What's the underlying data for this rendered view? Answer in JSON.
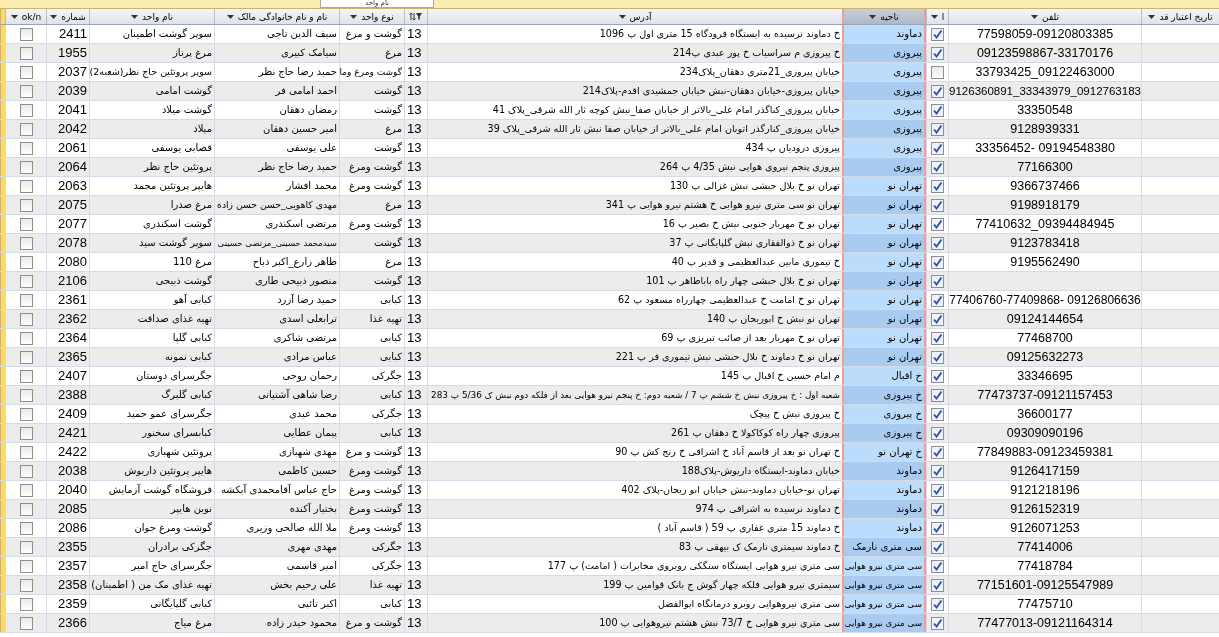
{
  "top_field": {
    "value": "نام واحد"
  },
  "table": {
    "columns": [
      {
        "label": "تاریخ اعتبار قد",
        "kind": "date",
        "selected": false
      },
      {
        "label": "تلفن",
        "kind": "phone",
        "selected": false
      },
      {
        "label": "ا",
        "kind": "checkbox",
        "selected": false
      },
      {
        "label": "ناحیه",
        "kind": "text",
        "selected": true
      },
      {
        "label": "آدرس",
        "kind": "text",
        "selected": false
      },
      {
        "kind": "code",
        "selected": false
      },
      {
        "label": "نوع واحد",
        "kind": "text",
        "selected": false
      },
      {
        "label": "نام و نام خانوادگی مالک",
        "kind": "text",
        "selected": false
      },
      {
        "label": "نام واحد",
        "kind": "text",
        "selected": false
      },
      {
        "label": "شماره",
        "kind": "text",
        "selected": false
      },
      {
        "label": "ok/n",
        "kind": "checkbox",
        "selected": false
      }
    ],
    "rows": [
      {
        "ok": false,
        "number": "2411",
        "unit_name": "سوپر گوشت اطمینان",
        "owner": "سیف الدین تاجی",
        "unit_type": "گوشت و مرغ",
        "column_6": "13",
        "address": "خ دماوند نرسیده به ایستگاه فرودگاه 15 متری اول پ 1096",
        "region": "دماوند",
        "column_9": true,
        "phone": "77598059-09120803385"
      },
      {
        "ok": false,
        "number": "1955",
        "unit_name": "مرغ پرناز",
        "owner": "سیامک کبیری",
        "unit_type": "مرغ",
        "column_6": "13",
        "address": "خ پیروزی م سراسیاب خ پور عبدی  پ214",
        "region": "پیروزی",
        "column_9": true,
        "phone": "09123598867-33170176"
      },
      {
        "ok": false,
        "number": "2037",
        "unit_name": "سوپر پروتئین حاج نظر(شعبه2)",
        "owner": "حمید رضا حاج نظر",
        "unit_type": "گوشت ومرغ وما",
        "column_6": "13",
        "address": "خیابان پیروزی_21متری دهقان_پلاک234",
        "region": "پیروزی",
        "column_9": false,
        "phone": "33793425_09122463000"
      },
      {
        "ok": false,
        "number": "2039",
        "unit_name": "گوشت امامی",
        "owner": "احمد امامی فر",
        "unit_type": "گوشت",
        "column_6": "13",
        "address": "خیابان پیروزی-خیابان دهقان-نبش خیابان جمشیدی اقدم-پلاک214",
        "region": "پیروزی",
        "column_9": true,
        "phone": "9126360891_33343979_0912763183"
      },
      {
        "ok": false,
        "number": "2041",
        "unit_name": "گوشت میلاد",
        "owner": "رمضان دهقان",
        "unit_type": "گوشت",
        "column_6": "13",
        "address": "خیابان پیروزی_کناگذر امام علی_بالاتر از خیابان صفا_نبش کوچه ثار الله شرقی_پلاک 41",
        "region": "پیروزی",
        "column_9": true,
        "phone": "33350548"
      },
      {
        "ok": false,
        "number": "2042",
        "unit_name": "میلاد",
        "owner": "امیر حسین دهقان",
        "unit_type": "مرغ",
        "column_6": "13",
        "address": "خیابان پیروزی_کنارگذر اتوبان امام علی_بالاتر از خیابان صفا نبش ثار الله شرقی_پلاک 39",
        "region": "پیروزی",
        "column_9": true,
        "phone": "9128939331"
      },
      {
        "ok": false,
        "number": "2061",
        "unit_name": "قصابی یوسفی",
        "owner": "علی یوسفی",
        "unit_type": "گوشت",
        "column_6": "13",
        "address": "پیروزی درودیان پ 434",
        "region": "پیروزی",
        "column_9": true,
        "phone": "33356452- 09194548380"
      },
      {
        "ok": false,
        "number": "2064",
        "unit_name": "پروتئین حاج نظر",
        "owner": "حمید رضا حاج نظر",
        "unit_type": "گوشت ومرغ",
        "column_6": "13",
        "address": "پیروزی پنجم نیروی هوایی نبش 4/35 پ 264",
        "region": "پیروزی",
        "column_9": true,
        "phone": "77166300"
      },
      {
        "ok": false,
        "number": "2063",
        "unit_name": "هایپر پروتئین محمد",
        "owner": "محمد افشار",
        "unit_type": "گوشت ومرغ",
        "column_6": "13",
        "address": "تهران نو خ بلال حبشی نبش غزالی پ 130",
        "region": "تهران نو",
        "column_9": true,
        "phone": "9366737466"
      },
      {
        "ok": false,
        "number": "2075",
        "unit_name": "مرغ صدرا",
        "owner": "مهدی کاهویی_حسن حسن زاده",
        "unit_type": "مرغ",
        "column_6": "13",
        "address": "تهران نو سی متری نیرو هوایی خ هشتم نیرو هوایی پ 341",
        "region": "تهران نو",
        "column_9": true,
        "phone": "9198918179"
      },
      {
        "ok": false,
        "number": "2077",
        "unit_name": "گوشت اسکندری",
        "owner": "مرتضی اسکندری",
        "unit_type": "گوشت ومرغ",
        "column_6": "13",
        "address": "تهران نو خ مهربار جنوبی نبش خ بصیر پ 16",
        "region": "تهران نو",
        "column_9": true,
        "phone": "77410632_09394484945"
      },
      {
        "ok": false,
        "number": "2078",
        "unit_name": "سوپر گوشت سید",
        "owner": "سیدمحمد حسینی_مرتضی حسینی",
        "unit_type": "گوشت",
        "column_6": "13",
        "address": "تهران نو خ ذوالفقاری نبش گلپایگانی پ 37",
        "region": "تهران نو",
        "column_9": true,
        "phone": "9123783418"
      },
      {
        "ok": false,
        "number": "2080",
        "unit_name": "مرغ 110",
        "owner": "طاهر زارع_اکبر ذباح",
        "unit_type": "مرغ",
        "column_6": "13",
        "address": "خ تیموری مابین عبدالعظیمی و قدیر پ 40",
        "region": "تهران نو",
        "column_9": true,
        "phone": "9195562490"
      },
      {
        "ok": false,
        "number": "2106",
        "unit_name": "گوشت ذبیحی",
        "owner": "منصور ذبیحی طاری",
        "unit_type": "گوشت",
        "column_6": "13",
        "address": "تهران نو خ بلال حبشی چهار راه باباطاهر پ 101",
        "region": "تهران نو",
        "column_9": true
      },
      {
        "ok": false,
        "number": "2361",
        "unit_name": "کبابی آهو",
        "owner": "حمید رضا آزرد",
        "unit_type": "کبابی",
        "column_6": "13",
        "address": "تهران نو خ امامت خ عبدالعظیمی چهارراه مسعود پ 62",
        "region": "تهران نو",
        "column_9": true,
        "phone": "77406760-77409868- 09126806636"
      },
      {
        "ok": false,
        "number": "2362",
        "unit_name": "تهیه غذای صداقت",
        "owner": "ترابعلی اسدی",
        "unit_type": "تهیه غذا",
        "column_6": "13",
        "address": "تهران نو نبش خ ابوریحان پ 140",
        "region": "تهران نو",
        "column_9": true,
        "phone": "09124144654"
      },
      {
        "ok": false,
        "number": "2364",
        "unit_name": "کبابی گلپا",
        "owner": "مرتضی شاکری",
        "unit_type": "کبابی",
        "column_6": "13",
        "address": "تهران نو خ مهربار بعد از صائب تبریزی پ 69",
        "region": "تهران نو",
        "column_9": true,
        "phone": "77468700"
      },
      {
        "ok": false,
        "number": "2365",
        "unit_name": "کبابی نمونه",
        "owner": "عباس مرادی",
        "unit_type": "کبابی",
        "column_6": "13",
        "address": "تهران نو خ دماوند خ بلال حبشی نبش تیموری فر پ 221",
        "region": "تهران نو",
        "column_9": true,
        "phone": "09125632273"
      },
      {
        "ok": false,
        "number": "2407",
        "unit_name": "جگرسرای دوستان",
        "owner": "رحمان روحی",
        "unit_type": "جگرکی",
        "column_6": "13",
        "address": "م امام حسین خ اقبال پ 145",
        "region": "خ اقبال",
        "column_9": true,
        "phone": "33346695"
      },
      {
        "ok": false,
        "number": "2388",
        "unit_name": "کبابی گلبرگ",
        "owner": "رضا شاهی آشتیانی",
        "unit_type": "کبابی",
        "column_6": "13",
        "address": "شعبه اول : خ پیروزی نبش خ ششم پ 7 / شعبه دوم: خ پنجم نیرو هوایی بعد از فلکه دوم نبش ک 5/36 پ 283",
        "region": "خ پیروزی",
        "column_9": true,
        "phone": "77473737-09121157453"
      },
      {
        "ok": false,
        "number": "2409",
        "unit_name": "جگرسرای عمو حمید",
        "owner": "محمد عیدی",
        "unit_type": "جگرکی",
        "column_6": "13",
        "address": "خ پیروزی نبش خ پیچک",
        "region": "خ پیروزی",
        "column_9": true,
        "phone": "36600177"
      },
      {
        "ok": false,
        "number": "2421",
        "unit_name": "کبابسرای سخنور",
        "owner": "پیمان عطایی",
        "unit_type": "کبابی",
        "column_6": "13",
        "address": "پیروزی چهار راه کوکاکولا خ دهقان پ 261",
        "region": "خ پیروزی",
        "column_9": true,
        "phone": "09309090196"
      },
      {
        "ok": false,
        "number": "2422",
        "unit_name": "پروتئین شهبازی",
        "owner": "مهدی شهبازی",
        "unit_type": "گوشت و مرغ",
        "column_6": "13",
        "address": "خ تهران نو بعد از قاسم آباد خ اشراقی خ رنج کش پ 90",
        "region": "خ تهران نو",
        "column_9": true,
        "phone": "77849883-09123459381"
      },
      {
        "ok": false,
        "number": "2038",
        "unit_name": "هایپر پروتئین داریوش",
        "owner": "حسین کاظمی",
        "unit_type": "گوشت ومرغ",
        "column_6": "13",
        "address": "خیابان دماوند-ایستگاه داریوش-پلاک188",
        "region": "دماوند",
        "column_9": true,
        "phone": "9126417159"
      },
      {
        "ok": false,
        "number": "2040",
        "unit_name": "فروشگاه گوشت آزمایش",
        "owner": "حاج عباس آقامحمدی آبکشه",
        "unit_type": "گوشت ومرغ",
        "column_6": "13",
        "address": "تهران نو-خیابان دماوند-نبش خیابان ابو ریحان-پلاک 402",
        "region": "دماوند",
        "column_9": true,
        "phone": "9121218196"
      },
      {
        "ok": false,
        "number": "2085",
        "unit_name": "نوین هایپر",
        "owner": "بختیار آکنده",
        "unit_type": "گوشت ومرغ",
        "column_6": "13",
        "address": "خ دماوند نرسیده به اشراقی پ 974",
        "region": "دماوند",
        "column_9": true,
        "phone": "9126152319"
      },
      {
        "ok": false,
        "number": "2086",
        "unit_name": "گوشت ومرغ جوان",
        "owner": "ملا الله صالحی وزیری",
        "unit_type": "گوشت ومرغ",
        "column_6": "13",
        "address": "خ دماوند 15 متری غفاری پ 59 ( قاسم آباد )",
        "region": "دماوند",
        "column_9": true,
        "phone": "9126071253"
      },
      {
        "ok": false,
        "number": "2355",
        "unit_name": "جگرکی برادران",
        "owner": "مهدی مهری",
        "unit_type": "جگرکی",
        "column_6": "13",
        "address": "خ دماوند سیمتری نارمک ک بیهقی پ 83",
        "region": "سی متری نارمک",
        "column_9": true,
        "phone": "77414006"
      },
      {
        "ok": false,
        "number": "2357",
        "unit_name": "جگرسرای حاج امیر",
        "owner": "امیر قاسمی",
        "unit_type": "جگرکی",
        "column_6": "13",
        "address": "سی متری نیرو هوایی ایستگاه سنگکی روبروی مخابرات ( امامت) پ 177",
        "region": "سی متری نیرو هوایی",
        "column_9": true,
        "phone": "77418784"
      },
      {
        "ok": false,
        "number": "2358",
        "unit_name": "تهیه غذای مک من ( اطمینان)",
        "owner": "علی رحیم بخش",
        "unit_type": "تهیه غذا",
        "column_6": "13",
        "address": "سیمتری نیرو هوایی فلکه چهار گوش ج بانک قوامین پ 199",
        "region": "سی متری نیرو هوایی",
        "column_9": true,
        "phone": "77151601-09125547989"
      },
      {
        "ok": false,
        "number": "2359",
        "unit_name": "کبابی گلپایگانی",
        "owner": "اکبر تائبی",
        "unit_type": "کبابی",
        "column_6": "13",
        "address": "سی متری نیروهوایی روبرو درمانگاه ابوالفضل",
        "region": "سی متری نیرو هوایی",
        "column_9": true,
        "phone": "77475710"
      },
      {
        "ok": false,
        "number": "2366",
        "unit_name": "مرغ میاج",
        "owner": "محمود حیدر زاده",
        "unit_type": "گوشت و مرغ",
        "column_6": "13",
        "address": "سی متری نیرو هوایی خ 73/7 نبش هشتم نیروهوایی پ 100",
        "region": "سی متری نیرو هوایی",
        "column_9": true,
        "phone": "77477013-09121164314"
      }
    ]
  }
}
